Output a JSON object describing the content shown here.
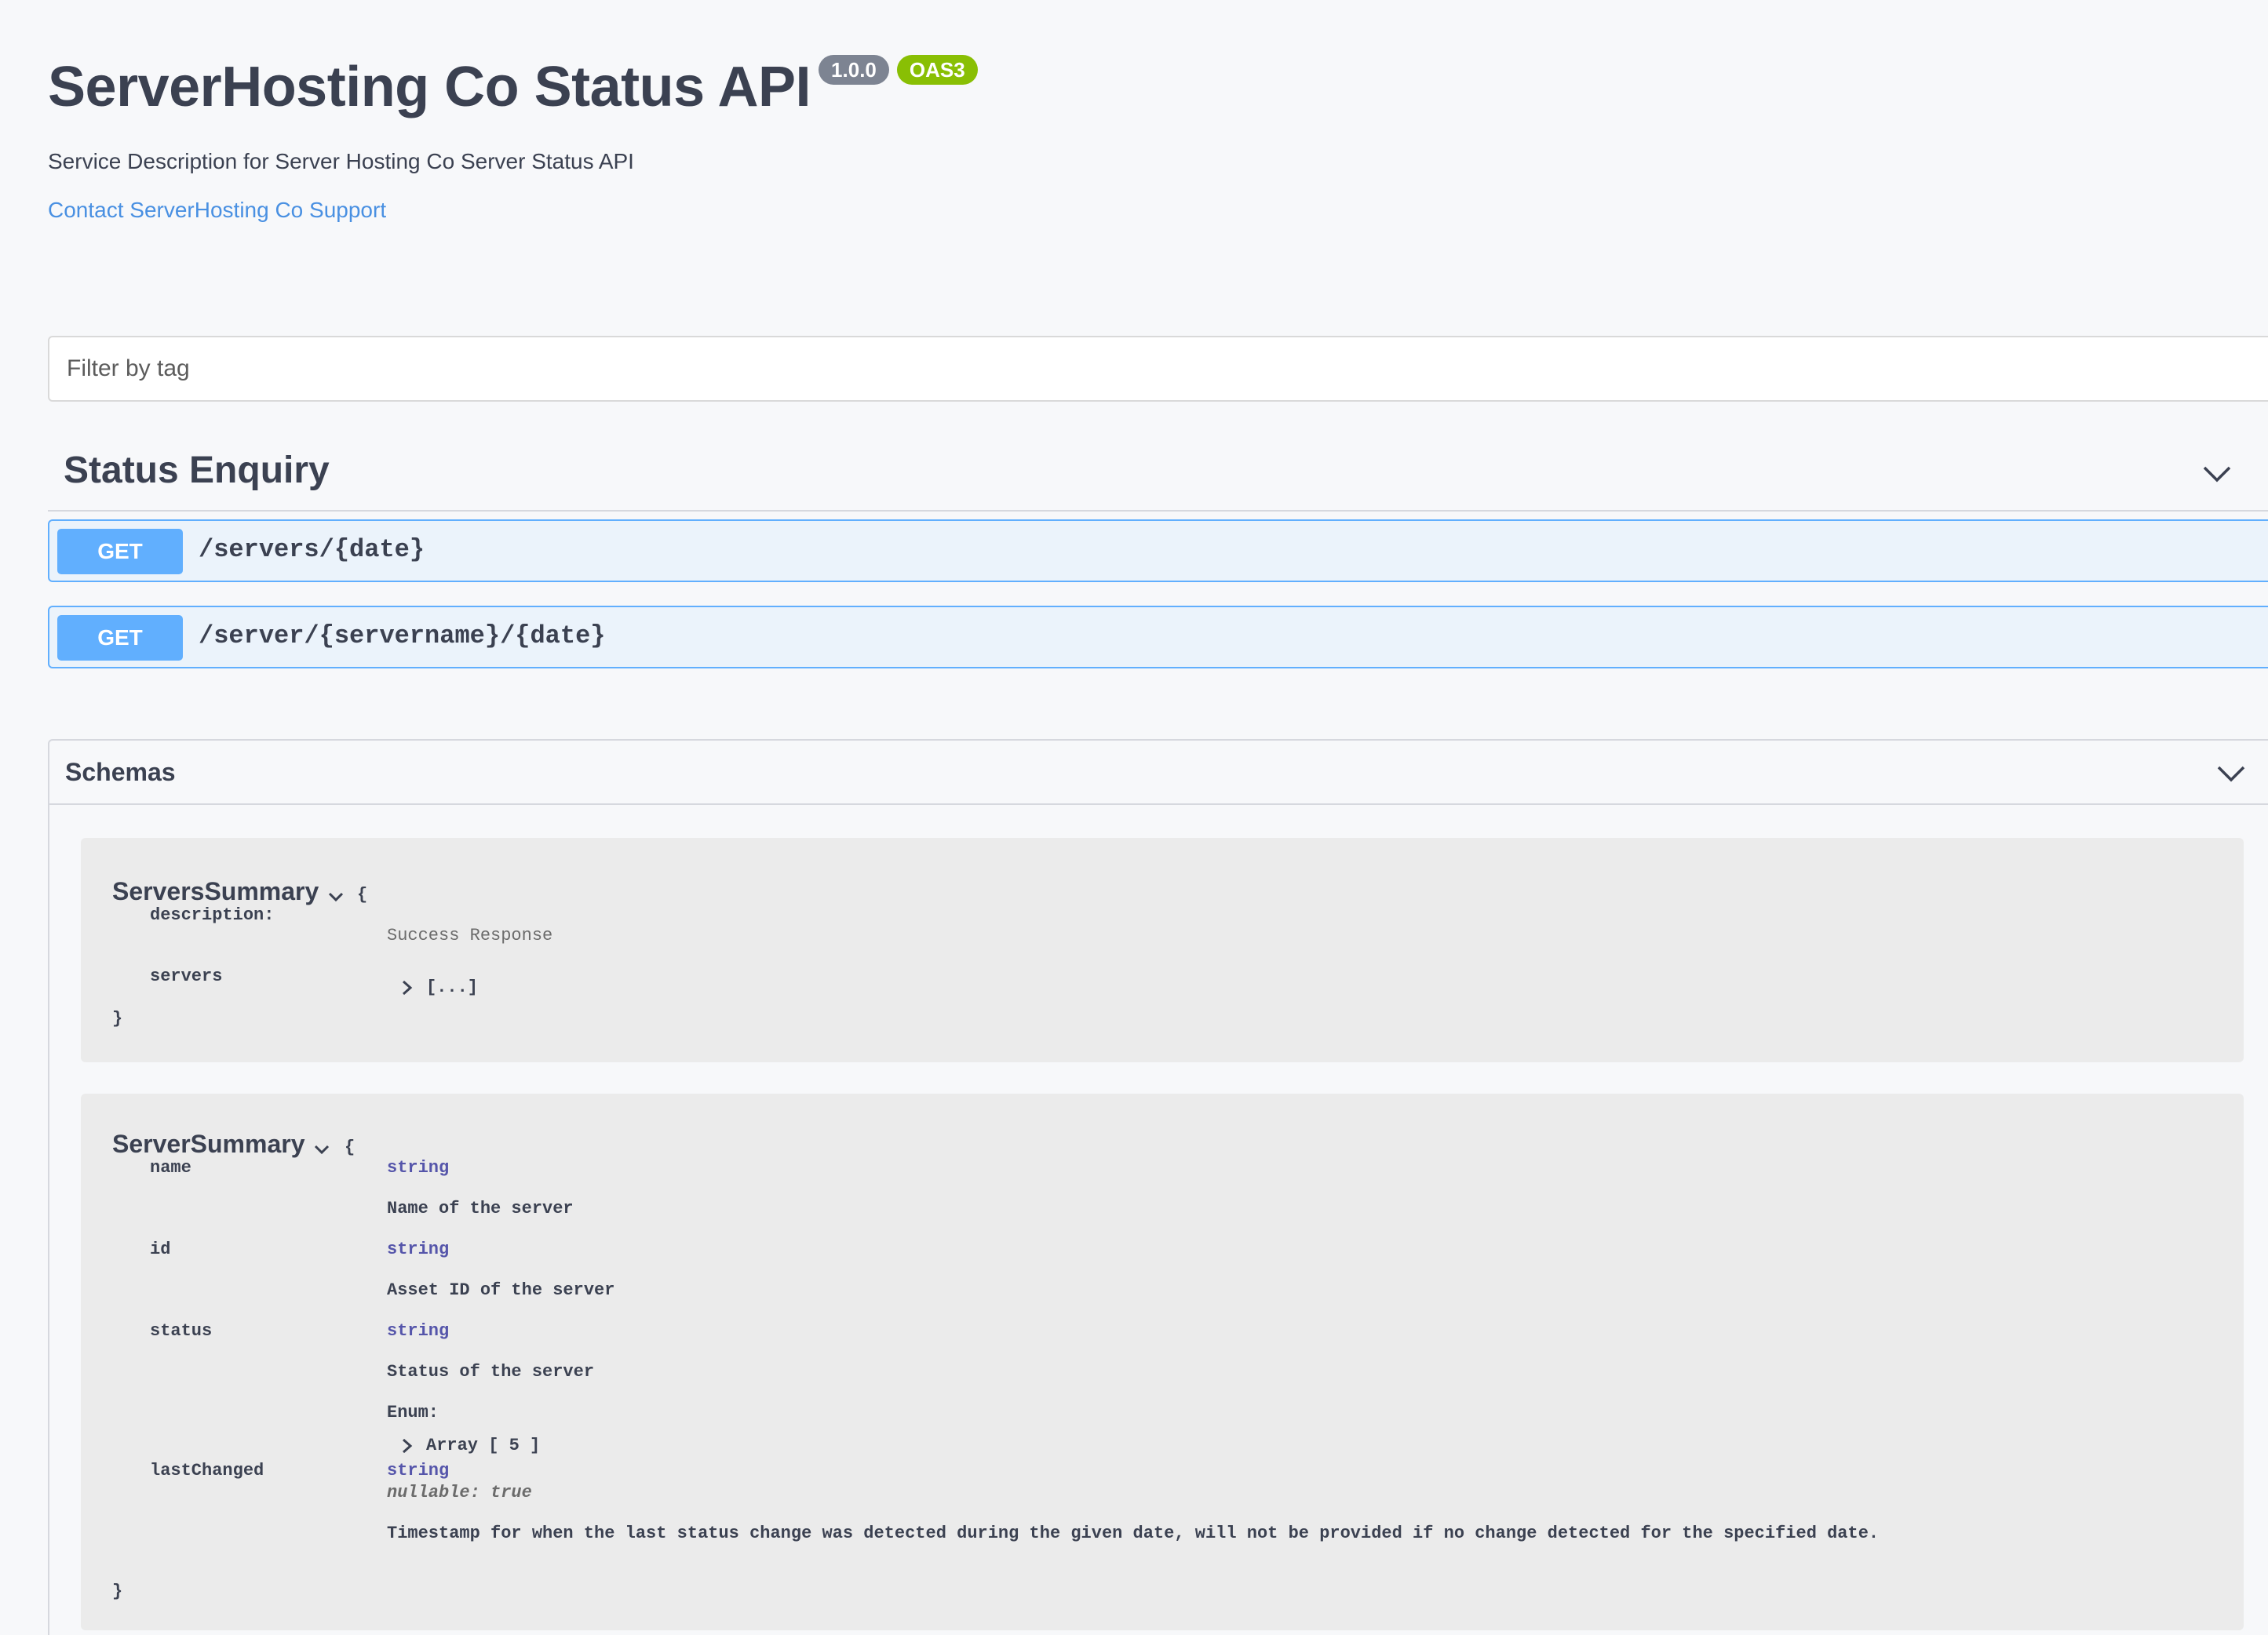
{
  "info": {
    "title": "ServerHosting Co Status API",
    "version": "1.0.0",
    "oas_badge": "OAS3",
    "description": "Service Description for Server Hosting Co Server Status API",
    "contact_label": "Contact ServerHosting Co Support"
  },
  "filter": {
    "placeholder": "Filter by tag"
  },
  "tag": {
    "name": "Status Enquiry",
    "operations": [
      {
        "method": "GET",
        "path": "/servers/{date}"
      },
      {
        "method": "GET",
        "path": "/server/{servername}/{date}"
      }
    ]
  },
  "schemas": {
    "title": "Schemas",
    "open_brace": "{",
    "close_brace": "}",
    "servers_summary": {
      "name": "ServersSummary",
      "description_label": "description:",
      "description_value": "Success Response",
      "servers_label": "servers",
      "servers_value": "[...]"
    },
    "server_summary": {
      "name": "ServerSummary",
      "name_prop": "name",
      "name_type": "string",
      "name_desc": "Name of the server",
      "id_prop": "id",
      "id_type": "string",
      "id_desc": "Asset ID of the server",
      "status_prop": "status",
      "status_type": "string",
      "status_desc": "Status of the server",
      "enum_label": "Enum:",
      "enum_value": "Array [ 5 ]",
      "last_changed_prop": "lastChanged",
      "last_changed_type": "string",
      "last_changed_nullable": "nullable: true",
      "last_changed_desc": "Timestamp for when the last status change was detected during the given date, will not be provided if no change detected for the specified date."
    }
  }
}
